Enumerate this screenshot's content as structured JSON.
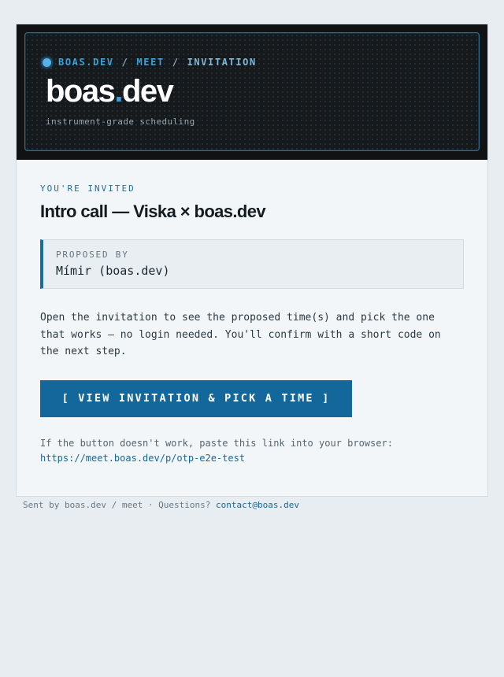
{
  "header": {
    "breadcrumb": {
      "brand": "BOAS.DEV",
      "section": "MEET",
      "current": "INVITATION",
      "separator": "/"
    },
    "logo": {
      "prefix": "boas",
      "dot": ".",
      "suffix": "dev"
    },
    "tagline": "instrument-grade scheduling"
  },
  "invite": {
    "eyebrow": "YOU'RE INVITED",
    "title": "Intro call — Viska × boas.dev",
    "proposer_label": "PROPOSED BY",
    "proposer_name": "Mímir (boas.dev)",
    "body": "Open the invitation to see the proposed time(s) and pick the one that works — no login needed. You'll confirm with a short code on the next step.",
    "cta_label": "[  VIEW INVITATION & PICK A TIME  ]",
    "fallback_text": "If the button doesn't work, paste this link into your browser:",
    "fallback_link": "https://meet.boas.dev/p/otp-e2e-test"
  },
  "footer": {
    "sent_by": "Sent by boas.dev / meet · Questions?",
    "contact": "contact@boas.dev"
  },
  "colors": {
    "accent": "#14679a",
    "hero_bg": "#101214",
    "page_bg": "#e8edf1"
  }
}
